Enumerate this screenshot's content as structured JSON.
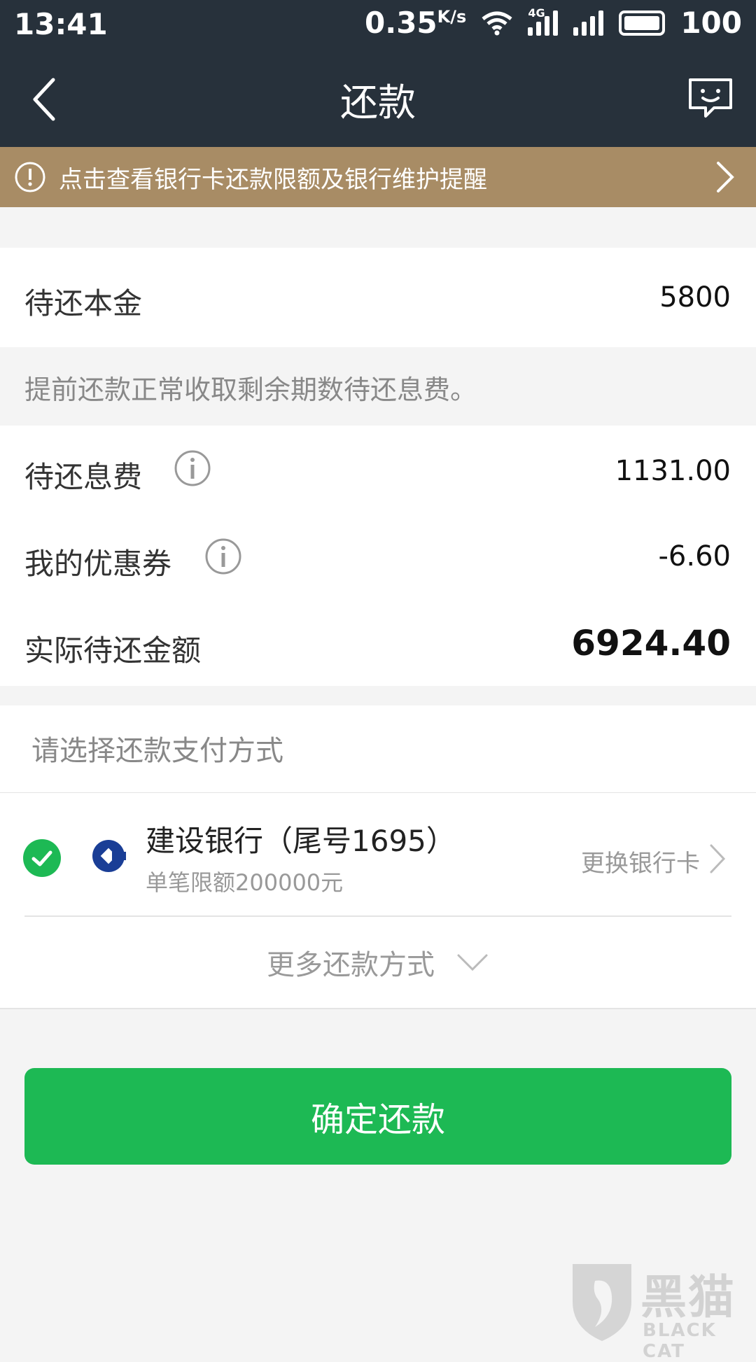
{
  "status_bar": {
    "time": "13:41",
    "speed": "0.35",
    "speed_unit": "K/s",
    "network": "4G",
    "battery": "100"
  },
  "nav": {
    "title": "还款"
  },
  "notice": {
    "text": "点击查看银行卡还款限额及银行维护提醒"
  },
  "principal": {
    "label": "待还本金",
    "value": "5800"
  },
  "hint": {
    "text": "提前还款正常收取剩余期数待还息费。"
  },
  "interest": {
    "label": "待还息费",
    "value": "1131.00"
  },
  "coupon": {
    "label": "我的优惠券",
    "value": "-6.60"
  },
  "total": {
    "label": "实际待还金额",
    "value": "6924.40"
  },
  "payment": {
    "header": "请选择还款支付方式",
    "bank_name": "建设银行（尾号1695）",
    "bank_limit": "单笔限额200000元",
    "change_label": "更换银行卡",
    "more_label": "更多还款方式"
  },
  "confirm_label": "确定还款",
  "watermark": {
    "text": "黑猫",
    "subtext": "BLACK CAT"
  },
  "colors": {
    "header_bg": "#27313b",
    "notice_bg": "#a88c65",
    "accent_green": "#1db954",
    "bank_blue": "#1a3e96"
  }
}
